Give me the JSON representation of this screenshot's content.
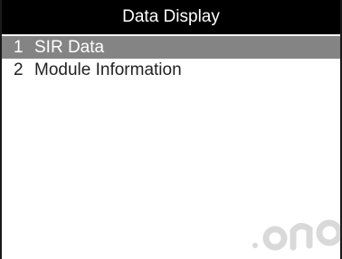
{
  "header": {
    "title": "Data Display"
  },
  "menu": {
    "items": [
      {
        "number": "1",
        "label": "SIR Data",
        "selected": true
      },
      {
        "number": "2",
        "label": "Module Information",
        "selected": false
      }
    ]
  },
  "colors": {
    "title_background": "#000000",
    "title_text": "#ffffff",
    "selection_background": "#848484",
    "selection_text": "#ffffff",
    "item_text": "#222222",
    "screen_background": "#ffffff",
    "frame": "#1a1a1a"
  },
  "watermark": {
    "text": "...ono"
  }
}
